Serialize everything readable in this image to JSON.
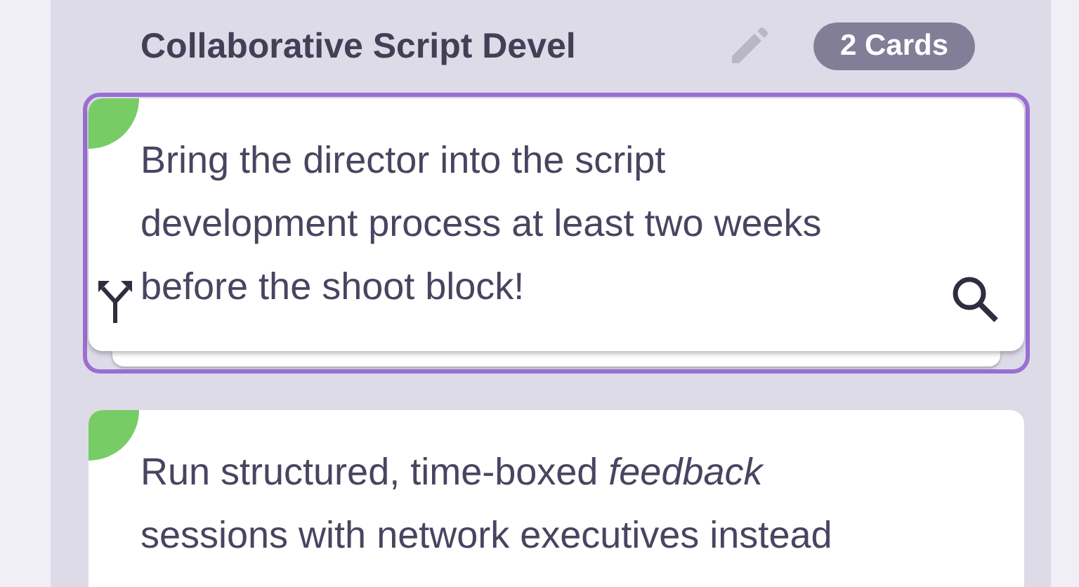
{
  "column": {
    "title": "Collaborative Script Devel",
    "count_badge": "2 Cards"
  },
  "cards": [
    {
      "text": "Bring the director into the script development process at least two weeks before the shoot block!",
      "selected": true,
      "stacked": true,
      "color": "#77cc66"
    },
    {
      "text": "Run structured, time-boxed *feedback* sessions with network executives instead",
      "selected": false,
      "stacked": false,
      "color": "#77cc66"
    }
  ]
}
